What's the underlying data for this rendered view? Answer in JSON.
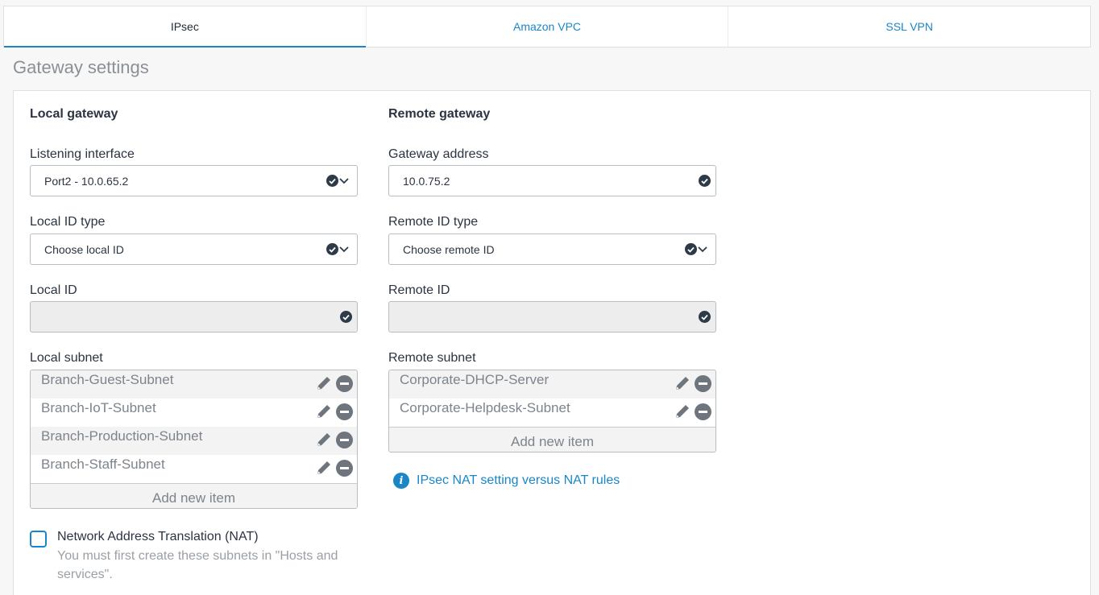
{
  "tabs": [
    {
      "label": "IPsec",
      "active": true
    },
    {
      "label": "Amazon VPC",
      "active": false
    },
    {
      "label": "SSL VPN",
      "active": false
    }
  ],
  "section_title": "Gateway settings",
  "local": {
    "heading": "Local gateway",
    "listening_interface": {
      "label": "Listening interface",
      "value": "Port2 - 10.0.65.2"
    },
    "local_id_type": {
      "label": "Local ID type",
      "value": "Choose local ID"
    },
    "local_id": {
      "label": "Local ID",
      "value": ""
    },
    "local_subnet": {
      "label": "Local subnet",
      "items": [
        "Branch-Guest-Subnet",
        "Branch-IoT-Subnet",
        "Branch-Production-Subnet",
        "Branch-Staff-Subnet"
      ],
      "add_label": "Add new item"
    },
    "nat": {
      "label": "Network Address Translation (NAT)",
      "checked": false,
      "hint": "You must first create these subnets in \"Hosts and services\"."
    }
  },
  "remote": {
    "heading": "Remote gateway",
    "gateway_address": {
      "label": "Gateway address",
      "value": "10.0.75.2"
    },
    "remote_id_type": {
      "label": "Remote ID type",
      "value": "Choose remote ID"
    },
    "remote_id": {
      "label": "Remote ID",
      "value": ""
    },
    "remote_subnet": {
      "label": "Remote subnet",
      "items": [
        "Corporate-DHCP-Server",
        "Corporate-Helpdesk-Subnet"
      ],
      "add_label": "Add new item"
    },
    "nat_link": "IPsec NAT setting versus NAT rules"
  },
  "colors": {
    "accent": "#1a86c8",
    "text": "#2b3440",
    "muted": "#7d848b"
  },
  "icons": {
    "valid": "check-circle-icon",
    "dropdown": "chevron-down-icon",
    "edit": "pencil-icon",
    "remove": "minus-circle-icon",
    "info": "info-icon"
  }
}
